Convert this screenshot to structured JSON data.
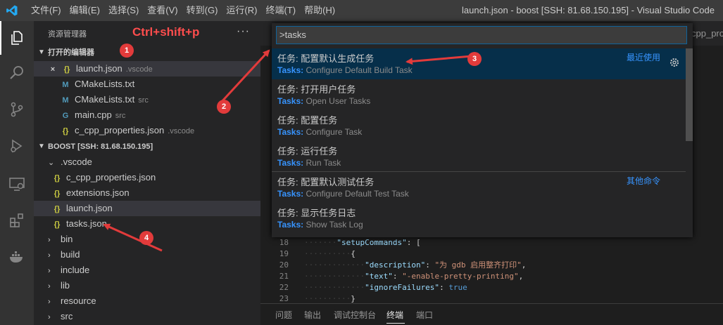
{
  "window": {
    "title": "launch.json - boost [SSH: 81.68.150.195] - Visual Studio Code"
  },
  "menu": [
    "文件(F)",
    "编辑(E)",
    "选择(S)",
    "查看(V)",
    "转到(G)",
    "运行(R)",
    "终端(T)",
    "帮助(H)"
  ],
  "sidebar": {
    "title": "资源管理器",
    "more": "···",
    "open_editors_header": "打开的编辑器",
    "open_editors": [
      {
        "icon": "close-icon",
        "glyph": "×",
        "glyph2": "{}",
        "name": "launch.json",
        "desc": ".vscode"
      },
      {
        "icon": "cmake-icon",
        "glyph": "M",
        "name": "CMakeLists.txt",
        "desc": ""
      },
      {
        "icon": "cmake-icon",
        "glyph": "M",
        "name": "CMakeLists.txt",
        "desc": "src"
      },
      {
        "icon": "cpp-icon",
        "glyph": "G",
        "name": "main.cpp",
        "desc": "src"
      },
      {
        "icon": "json-icon",
        "glyph": "{}",
        "name": "c_cpp_properties.json",
        "desc": ".vscode"
      }
    ],
    "workspace_header": "BOOST [SSH: 81.68.150.195]",
    "tree": [
      {
        "type": "folder-open",
        "name": ".vscode"
      },
      {
        "type": "json",
        "name": "c_cpp_properties.json"
      },
      {
        "type": "json",
        "name": "extensions.json"
      },
      {
        "type": "json",
        "name": "launch.json"
      },
      {
        "type": "json",
        "name": "tasks.json"
      },
      {
        "type": "folder",
        "name": "bin"
      },
      {
        "type": "folder",
        "name": "build"
      },
      {
        "type": "folder",
        "name": "include"
      },
      {
        "type": "folder",
        "name": "lib"
      },
      {
        "type": "folder",
        "name": "resource"
      },
      {
        "type": "folder",
        "name": "src"
      }
    ]
  },
  "editor": {
    "tab_fragment": "cpp_prope",
    "lines": [
      {
        "n": "18",
        "dots": "·······",
        "parts": [
          [
            "k",
            "\"setupCommands\""
          ],
          [
            "p",
            ": ["
          ]
        ]
      },
      {
        "n": "19",
        "dots": "··········",
        "parts": [
          [
            "p",
            "{"
          ]
        ]
      },
      {
        "n": "20",
        "dots": "·············",
        "parts": [
          [
            "k",
            "\"description\""
          ],
          [
            "p",
            ": "
          ],
          [
            "s",
            "\"为 gdb 启用整齐打印\""
          ],
          [
            "p",
            ","
          ]
        ]
      },
      {
        "n": "21",
        "dots": "·············",
        "parts": [
          [
            "k",
            "\"text\""
          ],
          [
            "p",
            ": "
          ],
          [
            "s",
            "\"-enable-pretty-printing\""
          ],
          [
            "p",
            ","
          ]
        ]
      },
      {
        "n": "22",
        "dots": "·············",
        "parts": [
          [
            "k",
            "\"ignoreFailures\""
          ],
          [
            "p",
            ": "
          ],
          [
            "b",
            "true"
          ]
        ]
      },
      {
        "n": "23",
        "dots": "··········",
        "parts": [
          [
            "p",
            "}"
          ]
        ]
      }
    ]
  },
  "panel": {
    "tabs": [
      "问题",
      "输出",
      "调试控制台",
      "终端",
      "端口"
    ],
    "active": 3
  },
  "palette": {
    "query": ">tasks",
    "items": [
      {
        "title": "任务: 配置默认生成任务",
        "prefix": "Tasks:",
        "detail": "Configure Default Build Task",
        "tag": "最近使用"
      },
      {
        "title": "任务: 打开用户任务",
        "prefix": "Tasks:",
        "detail": "Open User Tasks",
        "tag": ""
      },
      {
        "title": "任务: 配置任务",
        "prefix": "Tasks:",
        "detail": "Configure Task",
        "tag": ""
      },
      {
        "title": "任务: 运行任务",
        "prefix": "Tasks:",
        "detail": "Run Task",
        "tag": ""
      },
      {
        "title": "任务: 配置默认测试任务",
        "prefix": "Tasks:",
        "detail": "Configure Default Test Task",
        "tag": "其他命令"
      },
      {
        "title": "任务: 显示任务日志",
        "prefix": "Tasks:",
        "detail": "Show Task Log",
        "tag": ""
      }
    ]
  },
  "annotations": {
    "shortcut": "Ctrl+shift+p",
    "badges": [
      "1",
      "2",
      "3",
      "4"
    ]
  },
  "colors": {
    "accent": "#007acc",
    "annotation": "#e23b3b",
    "focus_row": "#062f4a",
    "json_icon": "#cbcb41",
    "link": "#3794ff"
  }
}
